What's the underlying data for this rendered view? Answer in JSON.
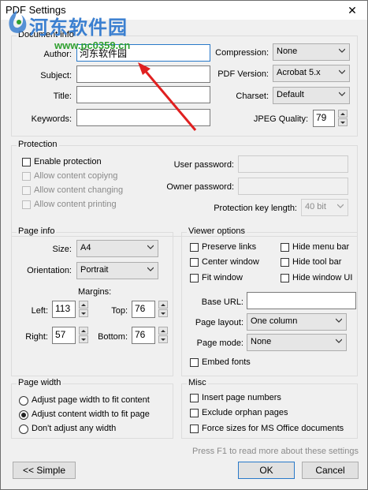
{
  "window": {
    "title": "PDF Settings",
    "close_glyph": "✕"
  },
  "watermark": {
    "text": "河东软件园",
    "url": "www.pc0359.cn"
  },
  "document_info": {
    "title": "Document info",
    "author_label": "Author:",
    "author_value": "河东软件园",
    "subject_label": "Subject:",
    "subject_value": "",
    "title_label": "Title:",
    "title_value": "",
    "keywords_label": "Keywords:",
    "keywords_value": "",
    "compression_label": "Compression:",
    "compression_value": "None",
    "pdf_version_label": "PDF Version:",
    "pdf_version_value": "Acrobat 5.x",
    "charset_label": "Charset:",
    "charset_value": "Default",
    "jpeg_quality_label": "JPEG Quality:",
    "jpeg_quality_value": "79"
  },
  "protection": {
    "title": "Protection",
    "enable_label": "Enable protection",
    "allow_copying_label": "Allow content copiyng",
    "allow_changing_label": "Allow content changing",
    "allow_printing_label": "Allow content printing",
    "user_password_label": "User password:",
    "owner_password_label": "Owner password:",
    "key_length_label": "Protection key length:",
    "key_length_value": "40 bit"
  },
  "page_info": {
    "title": "Page info",
    "size_label": "Size:",
    "size_value": "A4",
    "orientation_label": "Orientation:",
    "orientation_value": "Portrait",
    "margins_label": "Margins:",
    "left_label": "Left:",
    "left_value": "113",
    "top_label": "Top:",
    "top_value": "76",
    "right_label": "Right:",
    "right_value": "57",
    "bottom_label": "Bottom:",
    "bottom_value": "76"
  },
  "viewer_options": {
    "title": "Viewer options",
    "preserve_links": "Preserve links",
    "hide_menu_bar": "Hide menu bar",
    "center_window": "Center window",
    "hide_tool_bar": "Hide tool bar",
    "fit_window": "Fit window",
    "hide_window_ui": "Hide window UI",
    "base_url_label": "Base URL:",
    "base_url_value": "",
    "page_layout_label": "Page layout:",
    "page_layout_value": "One column",
    "page_mode_label": "Page mode:",
    "page_mode_value": "None",
    "embed_fonts": "Embed fonts"
  },
  "page_width": {
    "title": "Page width",
    "opt1": "Adjust page width to fit content",
    "opt2": "Adjust content width to fit page",
    "opt3": "Don't adjust any width",
    "selected": 2
  },
  "misc": {
    "title": "Misc",
    "insert_page_numbers": "Insert page numbers",
    "exclude_orphan_pages": "Exclude orphan pages",
    "force_sizes": "Force sizes for MS Office documents"
  },
  "footer": {
    "hint": "Press F1 to read more about these settings",
    "simple_button": "<< Simple",
    "ok_button": "OK",
    "cancel_button": "Cancel"
  },
  "colors": {
    "annotation_arrow": "#e02020",
    "accent": "#2979c9",
    "watermark_blue": "#3a7fd0",
    "watermark_green": "#30a030"
  }
}
